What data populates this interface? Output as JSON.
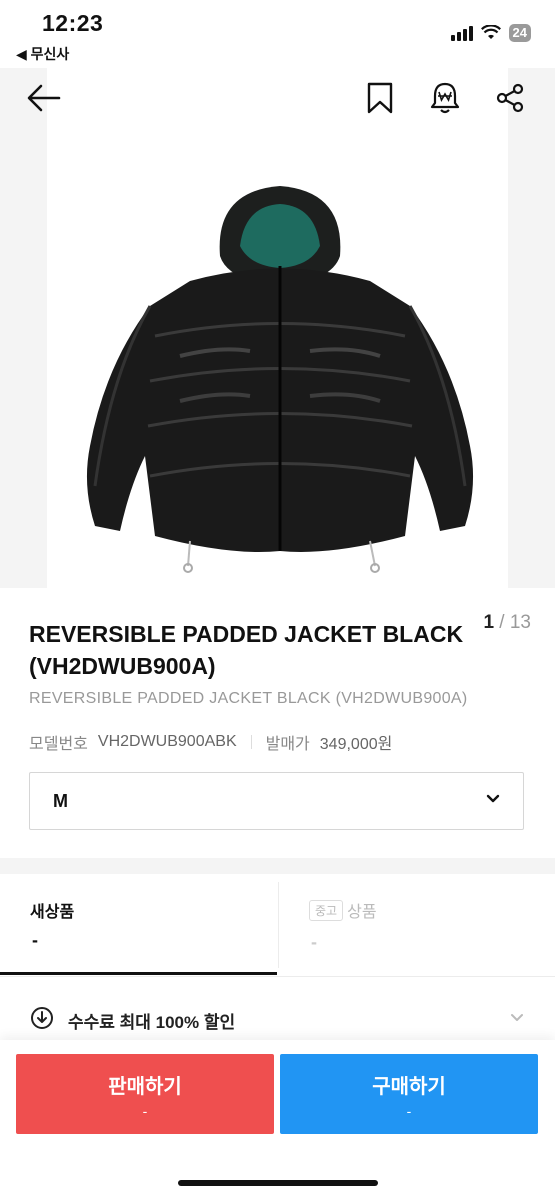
{
  "status_bar": {
    "time": "12:23",
    "back_app": "◀ 무신사",
    "battery": "24"
  },
  "header": {
    "back_icon": "arrow-left-icon",
    "bookmark_icon": "bookmark-icon",
    "alert_icon": "price-alert-bell-icon",
    "share_icon": "share-icon"
  },
  "gallery": {
    "current": "1",
    "separator": " / ",
    "total": "13"
  },
  "product": {
    "title": "REVERSIBLE PADDED JACKET BLACK (VH2DWUB900A)",
    "subtitle": "REVERSIBLE PADDED JACKET BLACK (VH2DWUB900A)",
    "model_label": "모델번호",
    "model_value": "VH2DWUB900ABK",
    "release_label": "발매가",
    "release_value": "349,000원"
  },
  "size_select": {
    "value": "M"
  },
  "tabs": {
    "new": {
      "label": "새상품",
      "value": "-"
    },
    "used": {
      "badge": "중고",
      "label": "상품",
      "value": "-"
    }
  },
  "fee": {
    "text": "수수료 최대 100% 할인"
  },
  "actions": {
    "sell": {
      "label": "판매하기",
      "sub": "-"
    },
    "buy": {
      "label": "구매하기",
      "sub": "-"
    }
  },
  "colors": {
    "sell": "#ef4f4f",
    "buy": "#2195f3"
  }
}
